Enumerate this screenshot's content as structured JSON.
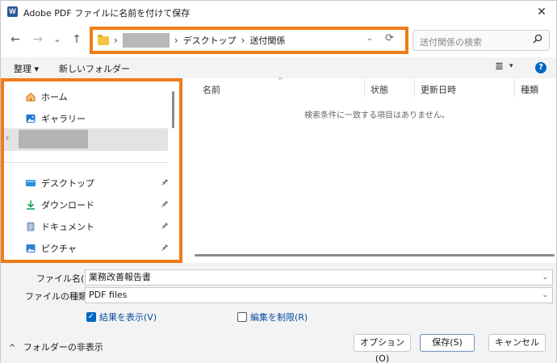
{
  "window": {
    "title": "Adobe PDF ファイルに名前を付けて保存",
    "app_icon_letter": "W",
    "close_glyph": "✕"
  },
  "nav": {
    "back_glyph": "←",
    "forward_glyph": "→",
    "recent_glyph": "⌄",
    "up_glyph": "↑",
    "breadcrumb": [
      "デスクトップ",
      "送付関係"
    ],
    "separator": "›",
    "dropdown_glyph": "⌄",
    "refresh_glyph": "⟳"
  },
  "search": {
    "placeholder": "送付関係の検索",
    "icon": "search-icon"
  },
  "toolbar": {
    "organize_label": "整理 ▾",
    "new_folder_label": "新しいフォルダー",
    "view_glyph": "≣",
    "view_caret": "▾",
    "help_glyph": "?"
  },
  "sidebar": {
    "items_top": [
      {
        "label": "ホーム",
        "icon": "home-icon",
        "glyph": "⌂",
        "color": "#e07a1f"
      },
      {
        "label": "ギャラリー",
        "icon": "gallery-icon",
        "glyph": "▣",
        "color": "#1e78d2"
      }
    ],
    "expand_glyph": "›",
    "pinned": [
      {
        "label": "デスクトップ",
        "icon": "desktop-icon",
        "glyph": "▬",
        "color": "#2b8fd6"
      },
      {
        "label": "ダウンロード",
        "icon": "download-icon",
        "glyph": "⤓",
        "color": "#1a9e5a"
      },
      {
        "label": "ドキュメント",
        "icon": "documents-icon",
        "glyph": "▤",
        "color": "#6f8fb8"
      },
      {
        "label": "ピクチャ",
        "icon": "pictures-icon",
        "glyph": "▣",
        "color": "#2e7fd6"
      }
    ],
    "pin_glyph": "📌"
  },
  "filelist": {
    "columns": [
      "名前",
      "状態",
      "更新日時",
      "種類"
    ],
    "sort_glyph": "^",
    "empty_message": "検索条件に一致する項目はありません。"
  },
  "form": {
    "filename_label": "ファイル名(N):",
    "filename_value": "業務改善報告書",
    "filetype_label": "ファイルの種類(T):",
    "filetype_value": "PDF files",
    "caret_glyph": "⌄",
    "show_results_label": "結果を表示(V)",
    "show_results_checked": true,
    "restrict_edit_label": "編集を制限(R)",
    "restrict_edit_checked": false,
    "check_glyph": "✓",
    "hide_folders_label": "フォルダーの非表示",
    "hide_folders_glyph": "^"
  },
  "buttons": {
    "options_label": "オプション(O)",
    "save_label": "保存(S)",
    "cancel_label": "キャンセル"
  },
  "colors": {
    "highlight": "#f07c17",
    "accent": "#0067c0"
  }
}
